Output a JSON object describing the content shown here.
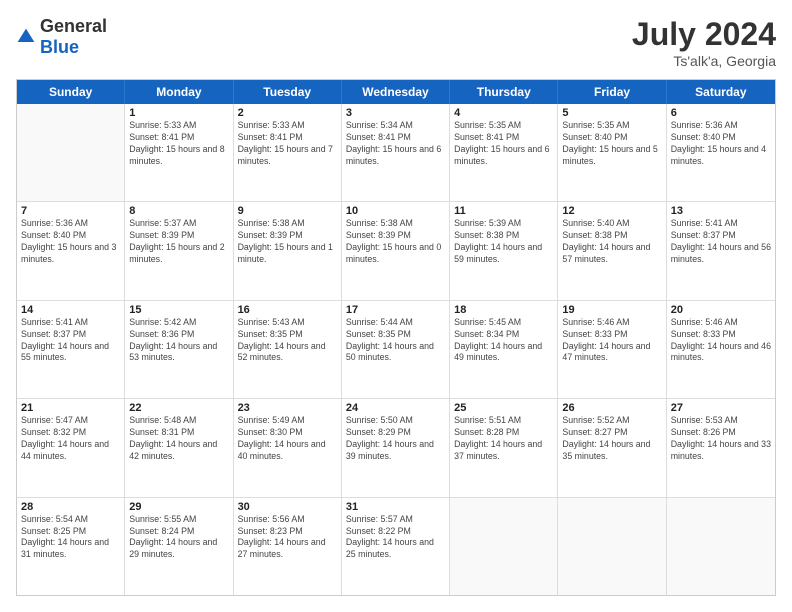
{
  "header": {
    "logo_general": "General",
    "logo_blue": "Blue",
    "title": "July 2024",
    "subtitle": "Ts'alk'a, Georgia"
  },
  "weekdays": [
    "Sunday",
    "Monday",
    "Tuesday",
    "Wednesday",
    "Thursday",
    "Friday",
    "Saturday"
  ],
  "rows": [
    [
      {
        "day": "",
        "sunrise": "",
        "sunset": "",
        "daylight": ""
      },
      {
        "day": "1",
        "sunrise": "5:33 AM",
        "sunset": "8:41 PM",
        "daylight": "15 hours and 8 minutes."
      },
      {
        "day": "2",
        "sunrise": "5:33 AM",
        "sunset": "8:41 PM",
        "daylight": "15 hours and 7 minutes."
      },
      {
        "day": "3",
        "sunrise": "5:34 AM",
        "sunset": "8:41 PM",
        "daylight": "15 hours and 6 minutes."
      },
      {
        "day": "4",
        "sunrise": "5:35 AM",
        "sunset": "8:41 PM",
        "daylight": "15 hours and 6 minutes."
      },
      {
        "day": "5",
        "sunrise": "5:35 AM",
        "sunset": "8:40 PM",
        "daylight": "15 hours and 5 minutes."
      },
      {
        "day": "6",
        "sunrise": "5:36 AM",
        "sunset": "8:40 PM",
        "daylight": "15 hours and 4 minutes."
      }
    ],
    [
      {
        "day": "7",
        "sunrise": "5:36 AM",
        "sunset": "8:40 PM",
        "daylight": "15 hours and 3 minutes."
      },
      {
        "day": "8",
        "sunrise": "5:37 AM",
        "sunset": "8:39 PM",
        "daylight": "15 hours and 2 minutes."
      },
      {
        "day": "9",
        "sunrise": "5:38 AM",
        "sunset": "8:39 PM",
        "daylight": "15 hours and 1 minute."
      },
      {
        "day": "10",
        "sunrise": "5:38 AM",
        "sunset": "8:39 PM",
        "daylight": "15 hours and 0 minutes."
      },
      {
        "day": "11",
        "sunrise": "5:39 AM",
        "sunset": "8:38 PM",
        "daylight": "14 hours and 59 minutes."
      },
      {
        "day": "12",
        "sunrise": "5:40 AM",
        "sunset": "8:38 PM",
        "daylight": "14 hours and 57 minutes."
      },
      {
        "day": "13",
        "sunrise": "5:41 AM",
        "sunset": "8:37 PM",
        "daylight": "14 hours and 56 minutes."
      }
    ],
    [
      {
        "day": "14",
        "sunrise": "5:41 AM",
        "sunset": "8:37 PM",
        "daylight": "14 hours and 55 minutes."
      },
      {
        "day": "15",
        "sunrise": "5:42 AM",
        "sunset": "8:36 PM",
        "daylight": "14 hours and 53 minutes."
      },
      {
        "day": "16",
        "sunrise": "5:43 AM",
        "sunset": "8:35 PM",
        "daylight": "14 hours and 52 minutes."
      },
      {
        "day": "17",
        "sunrise": "5:44 AM",
        "sunset": "8:35 PM",
        "daylight": "14 hours and 50 minutes."
      },
      {
        "day": "18",
        "sunrise": "5:45 AM",
        "sunset": "8:34 PM",
        "daylight": "14 hours and 49 minutes."
      },
      {
        "day": "19",
        "sunrise": "5:46 AM",
        "sunset": "8:33 PM",
        "daylight": "14 hours and 47 minutes."
      },
      {
        "day": "20",
        "sunrise": "5:46 AM",
        "sunset": "8:33 PM",
        "daylight": "14 hours and 46 minutes."
      }
    ],
    [
      {
        "day": "21",
        "sunrise": "5:47 AM",
        "sunset": "8:32 PM",
        "daylight": "14 hours and 44 minutes."
      },
      {
        "day": "22",
        "sunrise": "5:48 AM",
        "sunset": "8:31 PM",
        "daylight": "14 hours and 42 minutes."
      },
      {
        "day": "23",
        "sunrise": "5:49 AM",
        "sunset": "8:30 PM",
        "daylight": "14 hours and 40 minutes."
      },
      {
        "day": "24",
        "sunrise": "5:50 AM",
        "sunset": "8:29 PM",
        "daylight": "14 hours and 39 minutes."
      },
      {
        "day": "25",
        "sunrise": "5:51 AM",
        "sunset": "8:28 PM",
        "daylight": "14 hours and 37 minutes."
      },
      {
        "day": "26",
        "sunrise": "5:52 AM",
        "sunset": "8:27 PM",
        "daylight": "14 hours and 35 minutes."
      },
      {
        "day": "27",
        "sunrise": "5:53 AM",
        "sunset": "8:26 PM",
        "daylight": "14 hours and 33 minutes."
      }
    ],
    [
      {
        "day": "28",
        "sunrise": "5:54 AM",
        "sunset": "8:25 PM",
        "daylight": "14 hours and 31 minutes."
      },
      {
        "day": "29",
        "sunrise": "5:55 AM",
        "sunset": "8:24 PM",
        "daylight": "14 hours and 29 minutes."
      },
      {
        "day": "30",
        "sunrise": "5:56 AM",
        "sunset": "8:23 PM",
        "daylight": "14 hours and 27 minutes."
      },
      {
        "day": "31",
        "sunrise": "5:57 AM",
        "sunset": "8:22 PM",
        "daylight": "14 hours and 25 minutes."
      },
      {
        "day": "",
        "sunrise": "",
        "sunset": "",
        "daylight": ""
      },
      {
        "day": "",
        "sunrise": "",
        "sunset": "",
        "daylight": ""
      },
      {
        "day": "",
        "sunrise": "",
        "sunset": "",
        "daylight": ""
      }
    ]
  ]
}
